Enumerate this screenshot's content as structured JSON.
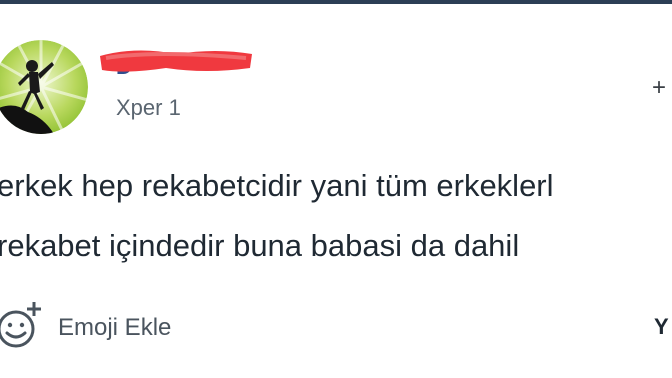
{
  "post": {
    "author": {
      "level": "Xper 1",
      "username_visible": "D"
    },
    "text_lines": [
      "erkek hep rekabetcidir yani tüm erkeklerl",
      "rekabet içindedir buna babasi da dahil"
    ],
    "actions": {
      "follow_symbol": "+",
      "emoji_label": "Emoji Ekle",
      "right_truncated_label": "Y"
    }
  },
  "colors": {
    "top_border": "#2c3e55",
    "redaction": "#f0393f",
    "username": "#2f4f8f",
    "avatar_green": "#9ac63a",
    "text": "#1f2933"
  },
  "icons": {
    "avatar": "dancer-silhouette-avatar",
    "emoji": "smiley-plus-icon"
  }
}
